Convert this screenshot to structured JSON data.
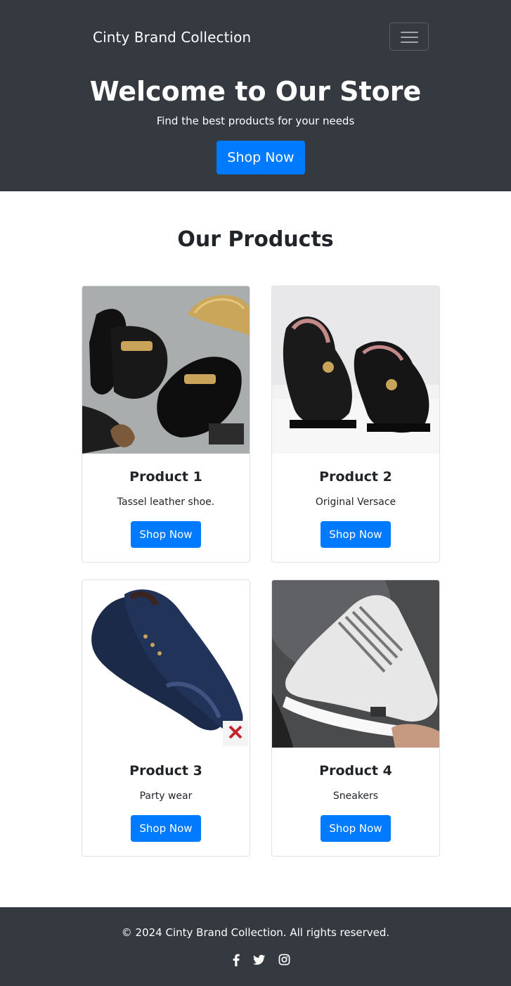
{
  "navbar": {
    "brand": "Cinty Brand Collection",
    "toggler_icon": "hamburger-menu-icon"
  },
  "hero": {
    "title": "Welcome to Our Store",
    "subtitle": "Find the best products for your needs",
    "button_label": "Shop Now"
  },
  "products_section": {
    "title": "Our Products",
    "items": [
      {
        "title": "Product 1",
        "description": "Tassel leather shoe.",
        "button_label": "Shop Now",
        "image_icon": "black-loafer-shoes-image"
      },
      {
        "title": "Product 2",
        "description": "Original Versace",
        "button_label": "Shop Now",
        "image_icon": "studded-loafer-shoes-image"
      },
      {
        "title": "Product 3",
        "description": "Party wear",
        "button_label": "Shop Now",
        "image_icon": "navy-patent-shoes-image"
      },
      {
        "title": "Product 4",
        "description": "Sneakers",
        "button_label": "Shop Now",
        "image_icon": "white-sneaker-image"
      }
    ]
  },
  "footer": {
    "copyright": "© 2024 Cinty Brand Collection. All rights reserved.",
    "social_icons": [
      "facebook-icon",
      "twitter-icon",
      "instagram-icon"
    ]
  },
  "colors": {
    "dark": "#343a40",
    "primary": "#007bff",
    "text": "#212529",
    "white": "#ffffff"
  }
}
